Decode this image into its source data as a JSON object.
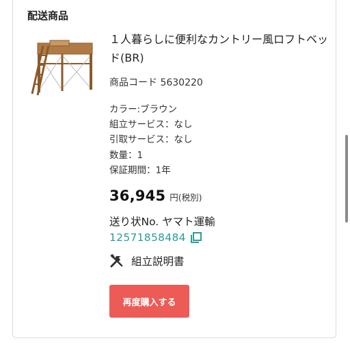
{
  "section_title": "配送商品",
  "product": {
    "image_icon": "loft-bed-image",
    "name": "１人暮らしに便利なカントリー風ロフトベッド(BR)",
    "code": "商品コード 5630220",
    "attributes": [
      "カラー:ブラウン",
      "組立サービス：なし",
      "引取サービス：なし",
      "数量：1",
      "保証期間：1年"
    ],
    "price": "36,945",
    "price_unit": "円(税別)"
  },
  "shipping": {
    "label": "送り状No. ヤマト運輸",
    "tracking_number": "12571858484",
    "copy_icon": "copy-icon",
    "tracking_color": "#2a9d9a"
  },
  "manual": {
    "icon": "tools-icon",
    "label": "組立説明書"
  },
  "rebuy_button": {
    "label": "再度購入する",
    "color": "#ec5b56"
  }
}
